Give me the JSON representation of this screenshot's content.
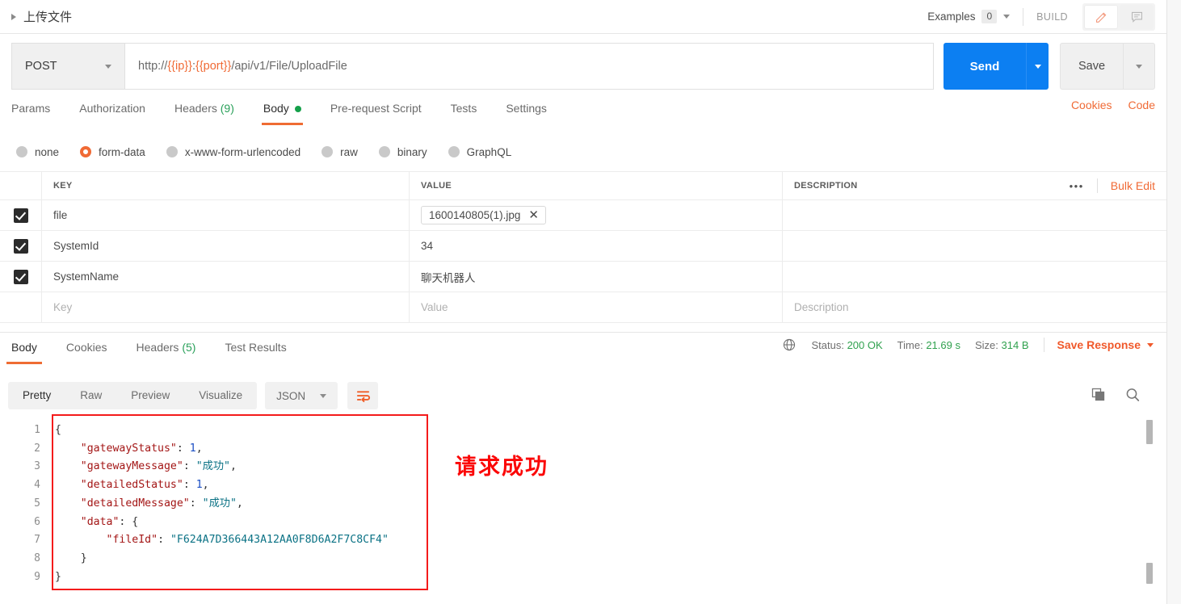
{
  "window": {
    "request_title": "上传文件",
    "examples_label": "Examples",
    "examples_count": "0",
    "build_label": "BUILD",
    "edit_icon": "pencil-icon",
    "comment_icon": "comment-icon"
  },
  "url_bar": {
    "method": "POST",
    "url_prefix": "http://",
    "url_var_ip": "{{ip}}",
    "url_colon": ":",
    "url_var_port": "{{port}}",
    "url_path": "/api/v1/File/UploadFile",
    "send_label": "Send",
    "save_label": "Save"
  },
  "request_tabs": {
    "items": [
      {
        "label": "Params",
        "badge": "",
        "active": false
      },
      {
        "label": "Authorization",
        "badge": "",
        "active": false
      },
      {
        "label": "Headers",
        "badge": "(9)",
        "active": false
      },
      {
        "label": "Body",
        "badge": "",
        "active": true
      },
      {
        "label": "Pre-request Script",
        "badge": "",
        "active": false
      },
      {
        "label": "Tests",
        "badge": "",
        "active": false
      },
      {
        "label": "Settings",
        "badge": "",
        "active": false
      }
    ],
    "cookies_link": "Cookies",
    "code_link": "Code"
  },
  "body_types": [
    {
      "label": "none",
      "selected": false
    },
    {
      "label": "form-data",
      "selected": true
    },
    {
      "label": "x-www-form-urlencoded",
      "selected": false
    },
    {
      "label": "raw",
      "selected": false
    },
    {
      "label": "binary",
      "selected": false
    },
    {
      "label": "GraphQL",
      "selected": false
    }
  ],
  "params_table": {
    "headers": {
      "key": "KEY",
      "value": "VALUE",
      "description": "DESCRIPTION"
    },
    "bulk_edit": "Bulk Edit",
    "more_menu": "•••",
    "rows": [
      {
        "checked": true,
        "key": "file",
        "value": "1600140805(1).jpg",
        "is_file": true,
        "description": ""
      },
      {
        "checked": true,
        "key": "SystemId",
        "value": "34",
        "is_file": false,
        "description": ""
      },
      {
        "checked": true,
        "key": "SystemName",
        "value": "聊天机器人",
        "is_file": false,
        "description": ""
      }
    ],
    "empty_row": {
      "key_placeholder": "Key",
      "value_placeholder": "Value",
      "desc_placeholder": "Description"
    }
  },
  "response_tabs": {
    "items": [
      {
        "label": "Body",
        "badge": "",
        "active": true
      },
      {
        "label": "Cookies",
        "badge": "",
        "active": false
      },
      {
        "label": "Headers",
        "badge": "(5)",
        "active": false
      },
      {
        "label": "Test Results",
        "badge": "",
        "active": false
      }
    ],
    "globe_icon": "globe-icon",
    "status_label": "Status:",
    "status_value": "200 OK",
    "time_label": "Time:",
    "time_value": "21.69 s",
    "size_label": "Size:",
    "size_value": "314 B",
    "save_response": "Save Response"
  },
  "viewer_toolbar": {
    "modes": [
      {
        "label": "Pretty",
        "active": true
      },
      {
        "label": "Raw",
        "active": false
      },
      {
        "label": "Preview",
        "active": false
      },
      {
        "label": "Visualize",
        "active": false
      }
    ],
    "format": "JSON",
    "wrap_icon": "word-wrap-icon",
    "copy_icon": "copy-icon",
    "search_icon": "search-icon"
  },
  "response_body": {
    "line_numbers": [
      "1",
      "2",
      "3",
      "4",
      "5",
      "6",
      "7",
      "8",
      "9"
    ],
    "lines": [
      {
        "n": 1,
        "text": "{"
      },
      {
        "n": 2,
        "text": "    \"gatewayStatus\": 1,"
      },
      {
        "n": 3,
        "text": "    \"gatewayMessage\": \"成功\","
      },
      {
        "n": 4,
        "text": "    \"detailedStatus\": 1,"
      },
      {
        "n": 5,
        "text": "    \"detailedMessage\": \"成功\","
      },
      {
        "n": 6,
        "text": "    \"data\": {"
      },
      {
        "n": 7,
        "text": "        \"fileId\": \"F624A7D366443A12AA0F8D6A2F7C8CF4\""
      },
      {
        "n": 8,
        "text": "    }"
      },
      {
        "n": 9,
        "text": "}"
      }
    ],
    "json": {
      "gatewayStatus": 1,
      "gatewayMessage": "成功",
      "detailedStatus": 1,
      "detailedMessage": "成功",
      "data": {
        "fileId": "F624A7D366443A12AA0F8D6A2F7C8CF4"
      }
    }
  },
  "annotation": {
    "text": "请求成功",
    "color": "#fb0707"
  },
  "colors": {
    "accent_orange": "#f06a35",
    "send_blue": "#0c7ff2",
    "status_green": "#30a14e",
    "annotation_red": "#fb0707"
  }
}
